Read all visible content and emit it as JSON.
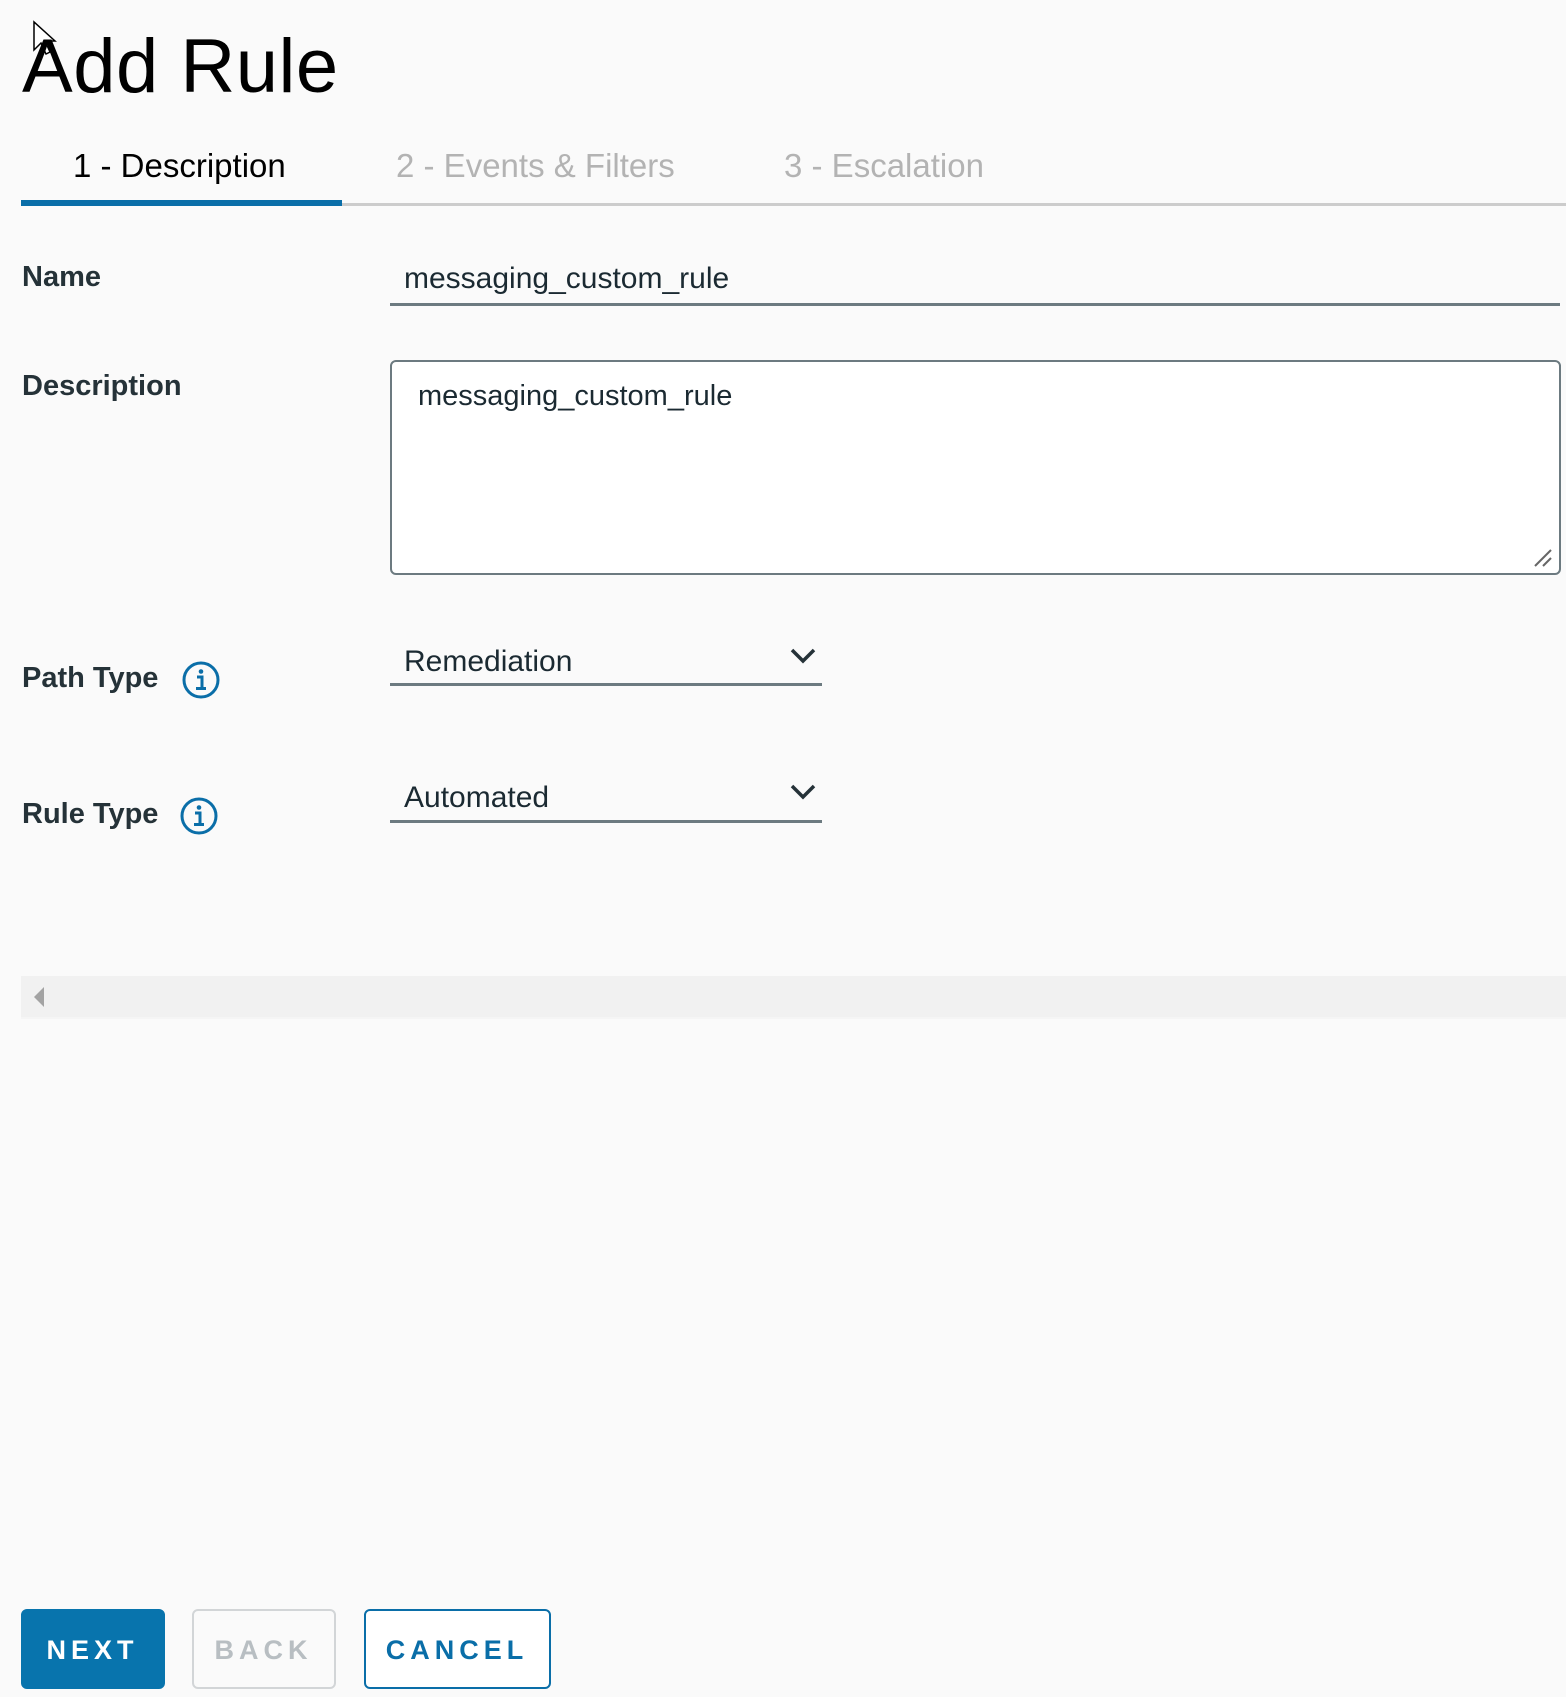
{
  "page": {
    "title": "Add Rule"
  },
  "tabs": [
    {
      "label": "1 - Description",
      "active": true
    },
    {
      "label": "2 - Events & Filters",
      "active": false
    },
    {
      "label": "3 - Escalation",
      "active": false
    }
  ],
  "form": {
    "name": {
      "label": "Name",
      "value": "messaging_custom_rule"
    },
    "description": {
      "label": "Description",
      "value": "messaging_custom_rule"
    },
    "path_type": {
      "label": "Path Type",
      "value": "Remediation",
      "icon": "info-icon"
    },
    "rule_type": {
      "label": "Rule Type",
      "value": "Automated",
      "icon": "info-icon"
    }
  },
  "footer": {
    "next_label": "NEXT",
    "back_label": "BACK",
    "cancel_label": "CANCEL"
  },
  "colors": {
    "accent": "#0a6ea8",
    "primary_button": "#0874ad",
    "inactive_tab": "#b3b3b3",
    "disabled_button_text": "#b8bec2",
    "input_border": "#6c7a80"
  }
}
